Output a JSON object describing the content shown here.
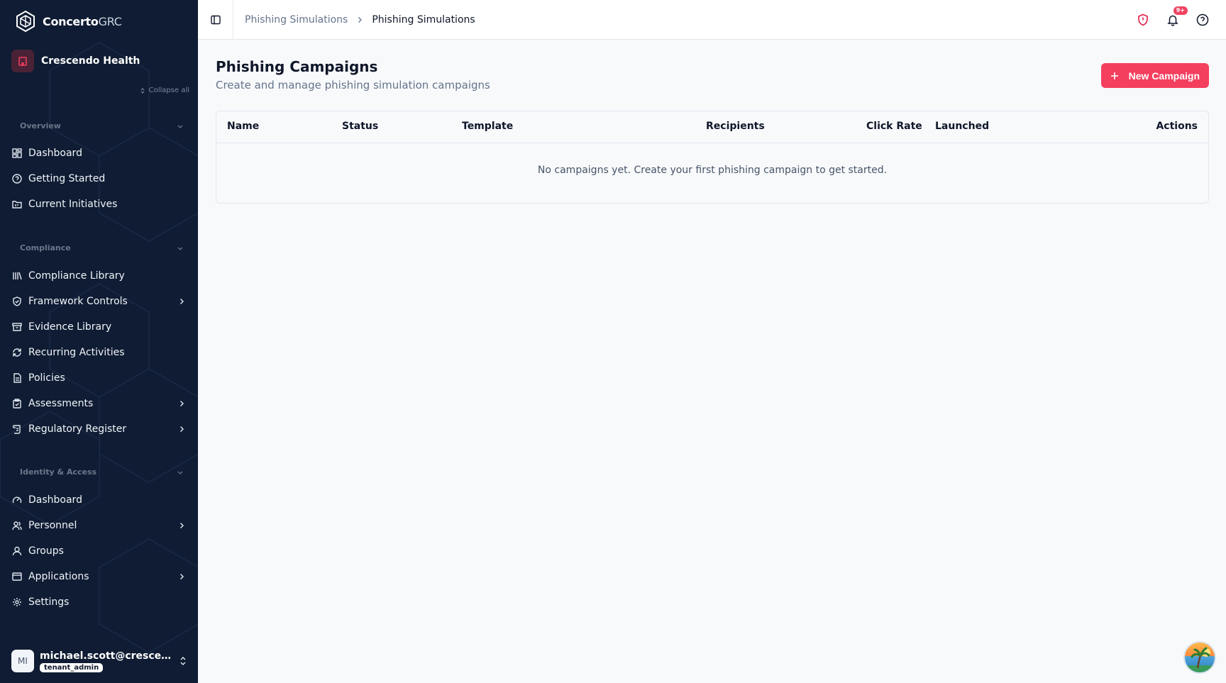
{
  "app": {
    "brand_bold": "Concerto",
    "brand_light": "GRC"
  },
  "org": {
    "name": "Crescendo Health"
  },
  "sidebar": {
    "collapse_all": "Collapse all",
    "sections": [
      {
        "title": "Overview",
        "items": [
          {
            "label": "Dashboard",
            "icon": "grid-icon"
          },
          {
            "label": "Getting Started",
            "icon": "help-circle-icon"
          },
          {
            "label": "Current Initiatives",
            "icon": "folder-kanban-icon"
          }
        ]
      },
      {
        "title": "Compliance",
        "items": [
          {
            "label": "Compliance Library",
            "icon": "library-icon"
          },
          {
            "label": "Framework Controls",
            "icon": "shield-check-icon",
            "has_children": true
          },
          {
            "label": "Evidence Library",
            "icon": "archive-icon"
          },
          {
            "label": "Recurring Activities",
            "icon": "refresh-icon"
          },
          {
            "label": "Policies",
            "icon": "file-text-icon"
          },
          {
            "label": "Assessments",
            "icon": "clipboard-check-icon",
            "has_children": true
          },
          {
            "label": "Regulatory Register",
            "icon": "scroll-icon",
            "has_children": true
          }
        ]
      },
      {
        "title": "Identity & Access",
        "items": [
          {
            "label": "Dashboard",
            "icon": "gauge-icon"
          },
          {
            "label": "Personnel",
            "icon": "users-icon",
            "has_children": true
          },
          {
            "label": "Groups",
            "icon": "user-group-icon"
          },
          {
            "label": "Applications",
            "icon": "app-window-icon",
            "has_children": true
          },
          {
            "label": "Settings",
            "icon": "gear-icon"
          }
        ]
      }
    ]
  },
  "user": {
    "initials": "MI",
    "email": "michael.scott@crescend...",
    "role": "tenant_admin"
  },
  "topbar": {
    "breadcrumb": [
      "Phishing Simulations",
      "Phishing Simulations"
    ],
    "notification_count": "9+"
  },
  "page": {
    "title": "Phishing Campaigns",
    "subtitle": "Create and manage phishing simulation campaigns",
    "new_button": "New Campaign"
  },
  "table": {
    "columns": [
      "Name",
      "Status",
      "Template",
      "Recipients",
      "Click Rate",
      "Launched",
      "Actions"
    ],
    "empty_message": "No campaigns yet. Create your first phishing campaign to get started."
  },
  "colors": {
    "sidebar_bg": "#0f1c33",
    "accent": "#f43f5e",
    "page_bg": "#f8f9fb"
  }
}
